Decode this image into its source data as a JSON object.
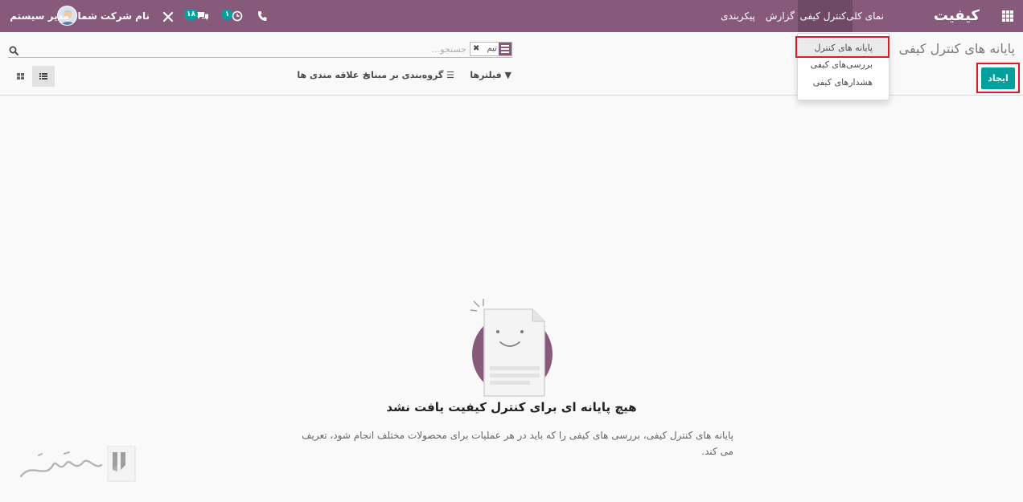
{
  "navbar": {
    "brand": "کیفیت",
    "menus": [
      "نمای کلی",
      "کنترل کیفی",
      "گزارش",
      "پیکربندی"
    ],
    "messages_count": "۱۸",
    "activities_count": "۱",
    "company": "نام شرکت شما",
    "user": "مدیر سیستم"
  },
  "dropdown": {
    "items": [
      "پایانه های کنترل",
      "بررسی‌های کیفی",
      "هشدارهای کیفی"
    ]
  },
  "control_panel": {
    "breadcrumb": "پایانه های کنترل کیفی",
    "create_label": "ایجاد",
    "search_placeholder": "جستجو...",
    "facet_label": "تیم",
    "filters_label": "فیلترها",
    "groupby_label": "گروه‌بندی بر مبنای",
    "favorites_label": "علاقه مندی ها"
  },
  "empty_state": {
    "title": "هیچ پایانه ای برای کنترل کیفیت یافت نشد",
    "text": "پایانه های کنترل کیفی، بررسی های کیفی را که باید در هر عملیات برای محصولات مختلف انجام شود، تعریف می کند."
  },
  "colors": {
    "brand": "#875a7b",
    "accent": "#00a09d",
    "highlight": "#dc1a2a"
  }
}
